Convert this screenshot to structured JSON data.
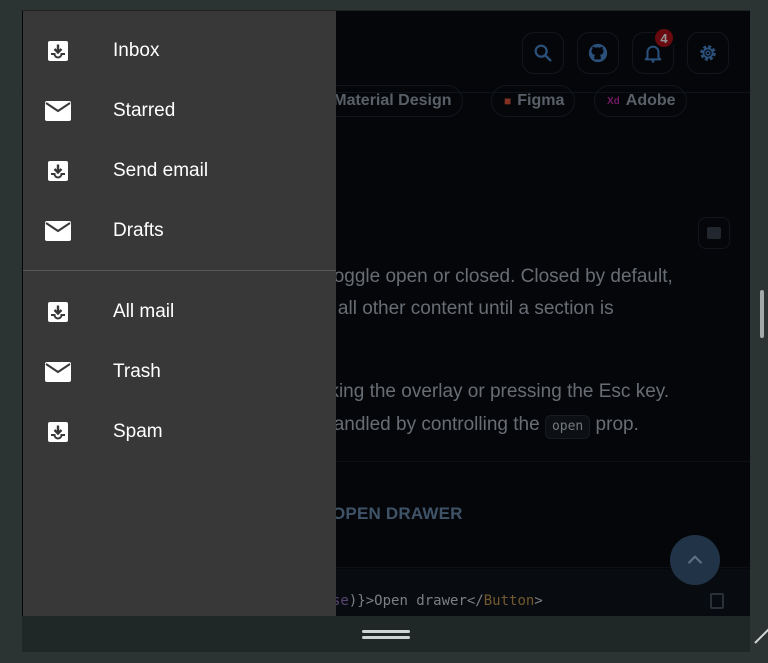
{
  "appbar": {
    "notification_count": "4"
  },
  "chips": [
    {
      "label": "Material Design"
    },
    {
      "label": "Figma"
    },
    {
      "label": "Adobe",
      "prefix": "Xd"
    }
  ],
  "content": {
    "para1_line1": "an toggle open or closed. Closed by default,",
    "para1_line2": "ove all other content until a section is",
    "para2_line1": "clicking the overlay or pressing the Esc key.",
    "para2_line2_before": "d, handled by controlling the",
    "para2_code": "open",
    "para2_line2_after": "prop.",
    "open_drawer_label": "OPEN DRAWER",
    "code_prefix": "se",
    "code_brace": ")}>",
    "code_text": "Open drawer</",
    "code_component": "Button",
    "code_suffix": ">"
  },
  "drawer": {
    "primary_items": [
      {
        "label": "Inbox",
        "icon": "inbox-icon"
      },
      {
        "label": "Starred",
        "icon": "mail-icon"
      },
      {
        "label": "Send email",
        "icon": "inbox-icon"
      },
      {
        "label": "Drafts",
        "icon": "mail-icon"
      }
    ],
    "secondary_items": [
      {
        "label": "All mail",
        "icon": "inbox-icon"
      },
      {
        "label": "Trash",
        "icon": "mail-icon"
      },
      {
        "label": "Spam",
        "icon": "inbox-icon"
      }
    ]
  },
  "colors": {
    "drawer_bg": "#383838",
    "accent_blue": "#4a8ad4",
    "badge_red": "#b3121a"
  }
}
